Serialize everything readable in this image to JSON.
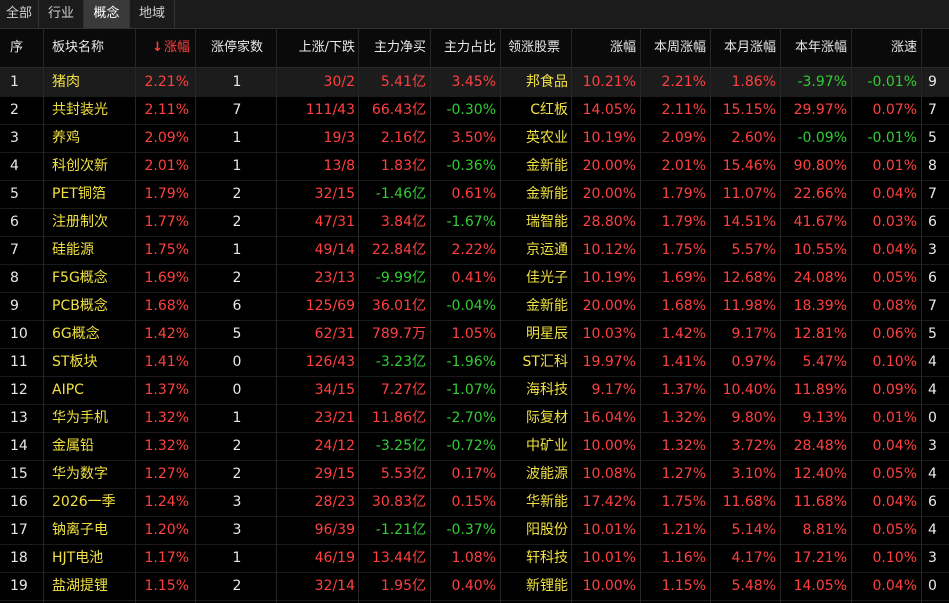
{
  "tabs": [
    "全部",
    "行业",
    "概念",
    "地域"
  ],
  "active_tab": 2,
  "headers": [
    "序",
    "板块名称",
    "涨幅",
    "涨停家数",
    "上涨/下跌",
    "主力净买",
    "主力占比",
    "领涨股票",
    "涨幅",
    "本周涨幅",
    "本月涨幅",
    "本年涨幅",
    "涨速"
  ],
  "rows": [
    {
      "idx": "1",
      "name": "猪肉",
      "chg": "2.21%",
      "limit": "1",
      "ud": "30/2",
      "net": "5.41亿",
      "ratio": "3.45%",
      "stock": "邦食品",
      "schg": "10.21%",
      "week": "2.21%",
      "month": "1.86%",
      "year": "-3.97%",
      "speed": "-0.01%",
      "extra": "9"
    },
    {
      "idx": "2",
      "name": "共封装光",
      "chg": "2.11%",
      "limit": "7",
      "ud": "111/43",
      "net": "66.43亿",
      "ratio": "-0.30%",
      "stock": "C红板",
      "schg": "14.05%",
      "week": "2.11%",
      "month": "15.15%",
      "year": "29.97%",
      "speed": "0.07%",
      "extra": "7"
    },
    {
      "idx": "3",
      "name": "养鸡",
      "chg": "2.09%",
      "limit": "1",
      "ud": "19/3",
      "net": "2.16亿",
      "ratio": "3.50%",
      "stock": "英农业",
      "schg": "10.19%",
      "week": "2.09%",
      "month": "2.60%",
      "year": "-0.09%",
      "speed": "-0.01%",
      "extra": "5"
    },
    {
      "idx": "4",
      "name": "科创次新",
      "chg": "2.01%",
      "limit": "1",
      "ud": "13/8",
      "net": "1.83亿",
      "ratio": "-0.36%",
      "stock": "金新能",
      "schg": "20.00%",
      "week": "2.01%",
      "month": "15.46%",
      "year": "90.80%",
      "speed": "0.01%",
      "extra": "8"
    },
    {
      "idx": "5",
      "name": "PET铜箔",
      "chg": "1.79%",
      "limit": "2",
      "ud": "32/15",
      "net": "-1.46亿",
      "ratio": "0.61%",
      "stock": "金新能",
      "schg": "20.00%",
      "week": "1.79%",
      "month": "11.07%",
      "year": "22.66%",
      "speed": "0.04%",
      "extra": "7"
    },
    {
      "idx": "6",
      "name": "注册制次",
      "chg": "1.77%",
      "limit": "2",
      "ud": "47/31",
      "net": "3.84亿",
      "ratio": "-1.67%",
      "stock": "瑞智能",
      "schg": "28.80%",
      "week": "1.79%",
      "month": "14.51%",
      "year": "41.67%",
      "speed": "0.03%",
      "extra": "6"
    },
    {
      "idx": "7",
      "name": "硅能源",
      "chg": "1.75%",
      "limit": "1",
      "ud": "49/14",
      "net": "22.84亿",
      "ratio": "2.22%",
      "stock": "京运通",
      "schg": "10.12%",
      "week": "1.75%",
      "month": "5.57%",
      "year": "10.55%",
      "speed": "0.04%",
      "extra": "3"
    },
    {
      "idx": "8",
      "name": "F5G概念",
      "chg": "1.69%",
      "limit": "2",
      "ud": "23/13",
      "net": "-9.99亿",
      "ratio": "0.41%",
      "stock": "佳光子",
      "schg": "10.19%",
      "week": "1.69%",
      "month": "12.68%",
      "year": "24.08%",
      "speed": "0.05%",
      "extra": "6"
    },
    {
      "idx": "9",
      "name": "PCB概念",
      "chg": "1.68%",
      "limit": "6",
      "ud": "125/69",
      "net": "36.01亿",
      "ratio": "-0.04%",
      "stock": "金新能",
      "schg": "20.00%",
      "week": "1.68%",
      "month": "11.98%",
      "year": "18.39%",
      "speed": "0.08%",
      "extra": "7"
    },
    {
      "idx": "10",
      "name": "6G概念",
      "chg": "1.42%",
      "limit": "5",
      "ud": "62/31",
      "net": "789.7万",
      "ratio": "1.05%",
      "stock": "明星辰",
      "schg": "10.03%",
      "week": "1.42%",
      "month": "9.17%",
      "year": "12.81%",
      "speed": "0.06%",
      "extra": "5"
    },
    {
      "idx": "11",
      "name": "ST板块",
      "chg": "1.41%",
      "limit": "0",
      "ud": "126/43",
      "net": "-3.23亿",
      "ratio": "-1.96%",
      "stock": "ST汇科",
      "schg": "19.97%",
      "week": "1.41%",
      "month": "0.97%",
      "year": "5.47%",
      "speed": "0.10%",
      "extra": "4"
    },
    {
      "idx": "12",
      "name": "AIPC",
      "chg": "1.37%",
      "limit": "0",
      "ud": "34/15",
      "net": "7.27亿",
      "ratio": "-1.07%",
      "stock": "海科技",
      "schg": "9.17%",
      "week": "1.37%",
      "month": "10.40%",
      "year": "11.89%",
      "speed": "0.09%",
      "extra": "4"
    },
    {
      "idx": "13",
      "name": "华为手机",
      "chg": "1.32%",
      "limit": "1",
      "ud": "23/21",
      "net": "11.86亿",
      "ratio": "-2.70%",
      "stock": "际复材",
      "schg": "16.04%",
      "week": "1.32%",
      "month": "9.80%",
      "year": "9.13%",
      "speed": "0.01%",
      "extra": "0"
    },
    {
      "idx": "14",
      "name": "金属铅",
      "chg": "1.32%",
      "limit": "2",
      "ud": "24/12",
      "net": "-3.25亿",
      "ratio": "-0.72%",
      "stock": "中矿业",
      "schg": "10.00%",
      "week": "1.32%",
      "month": "3.72%",
      "year": "28.48%",
      "speed": "0.04%",
      "extra": "3"
    },
    {
      "idx": "15",
      "name": "华为数字",
      "chg": "1.27%",
      "limit": "2",
      "ud": "29/15",
      "net": "5.53亿",
      "ratio": "0.17%",
      "stock": "波能源",
      "schg": "10.08%",
      "week": "1.27%",
      "month": "3.10%",
      "year": "12.40%",
      "speed": "0.05%",
      "extra": "4"
    },
    {
      "idx": "16",
      "name": "2026一季",
      "chg": "1.24%",
      "limit": "3",
      "ud": "28/23",
      "net": "30.83亿",
      "ratio": "0.15%",
      "stock": "华新能",
      "schg": "17.42%",
      "week": "1.75%",
      "month": "11.68%",
      "year": "11.68%",
      "speed": "0.04%",
      "extra": "6"
    },
    {
      "idx": "17",
      "name": "钠离子电",
      "chg": "1.20%",
      "limit": "3",
      "ud": "96/39",
      "net": "-1.21亿",
      "ratio": "-0.37%",
      "stock": "阳股份",
      "schg": "10.01%",
      "week": "1.21%",
      "month": "5.14%",
      "year": "8.81%",
      "speed": "0.05%",
      "extra": "4"
    },
    {
      "idx": "18",
      "name": "HJT电池",
      "chg": "1.17%",
      "limit": "1",
      "ud": "46/19",
      "net": "13.44亿",
      "ratio": "1.08%",
      "stock": "轩科技",
      "schg": "10.01%",
      "week": "1.16%",
      "month": "4.17%",
      "year": "17.21%",
      "speed": "0.10%",
      "extra": "3"
    },
    {
      "idx": "19",
      "name": "盐湖提锂",
      "chg": "1.15%",
      "limit": "2",
      "ud": "32/14",
      "net": "1.95亿",
      "ratio": "0.40%",
      "stock": "新锂能",
      "schg": "10.00%",
      "week": "1.15%",
      "month": "5.48%",
      "year": "14.05%",
      "speed": "0.04%",
      "extra": "0"
    }
  ]
}
